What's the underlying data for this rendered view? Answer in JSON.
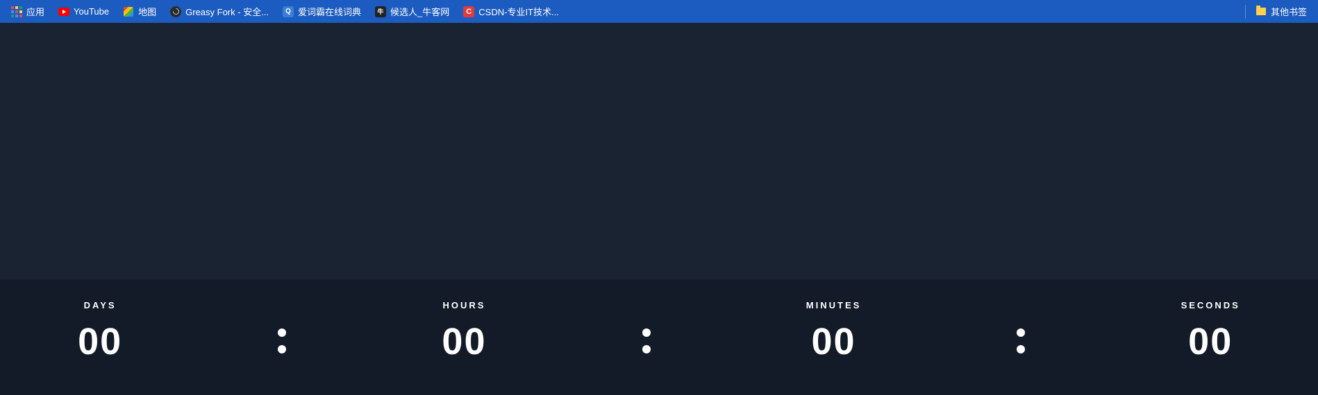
{
  "bookmarks": {
    "items": [
      {
        "label": "应用",
        "icon": "apps"
      },
      {
        "label": "YouTube",
        "icon": "youtube"
      },
      {
        "label": "地图",
        "icon": "maps"
      },
      {
        "label": "Greasy Fork - 安全...",
        "icon": "greasy"
      },
      {
        "label": "爱词霸在线词典",
        "icon": "dict"
      },
      {
        "label": "候选人_牛客网",
        "icon": "nowcoder"
      },
      {
        "label": "CSDN-专业IT技术...",
        "icon": "csdn"
      }
    ],
    "other_label": "其他书签"
  },
  "countdown": {
    "days": {
      "label": "DAYS",
      "value": "00"
    },
    "hours": {
      "label": "HOURS",
      "value": "00"
    },
    "minutes": {
      "label": "MINUTES",
      "value": "00"
    },
    "seconds": {
      "label": "SECONDS",
      "value": "00"
    }
  }
}
